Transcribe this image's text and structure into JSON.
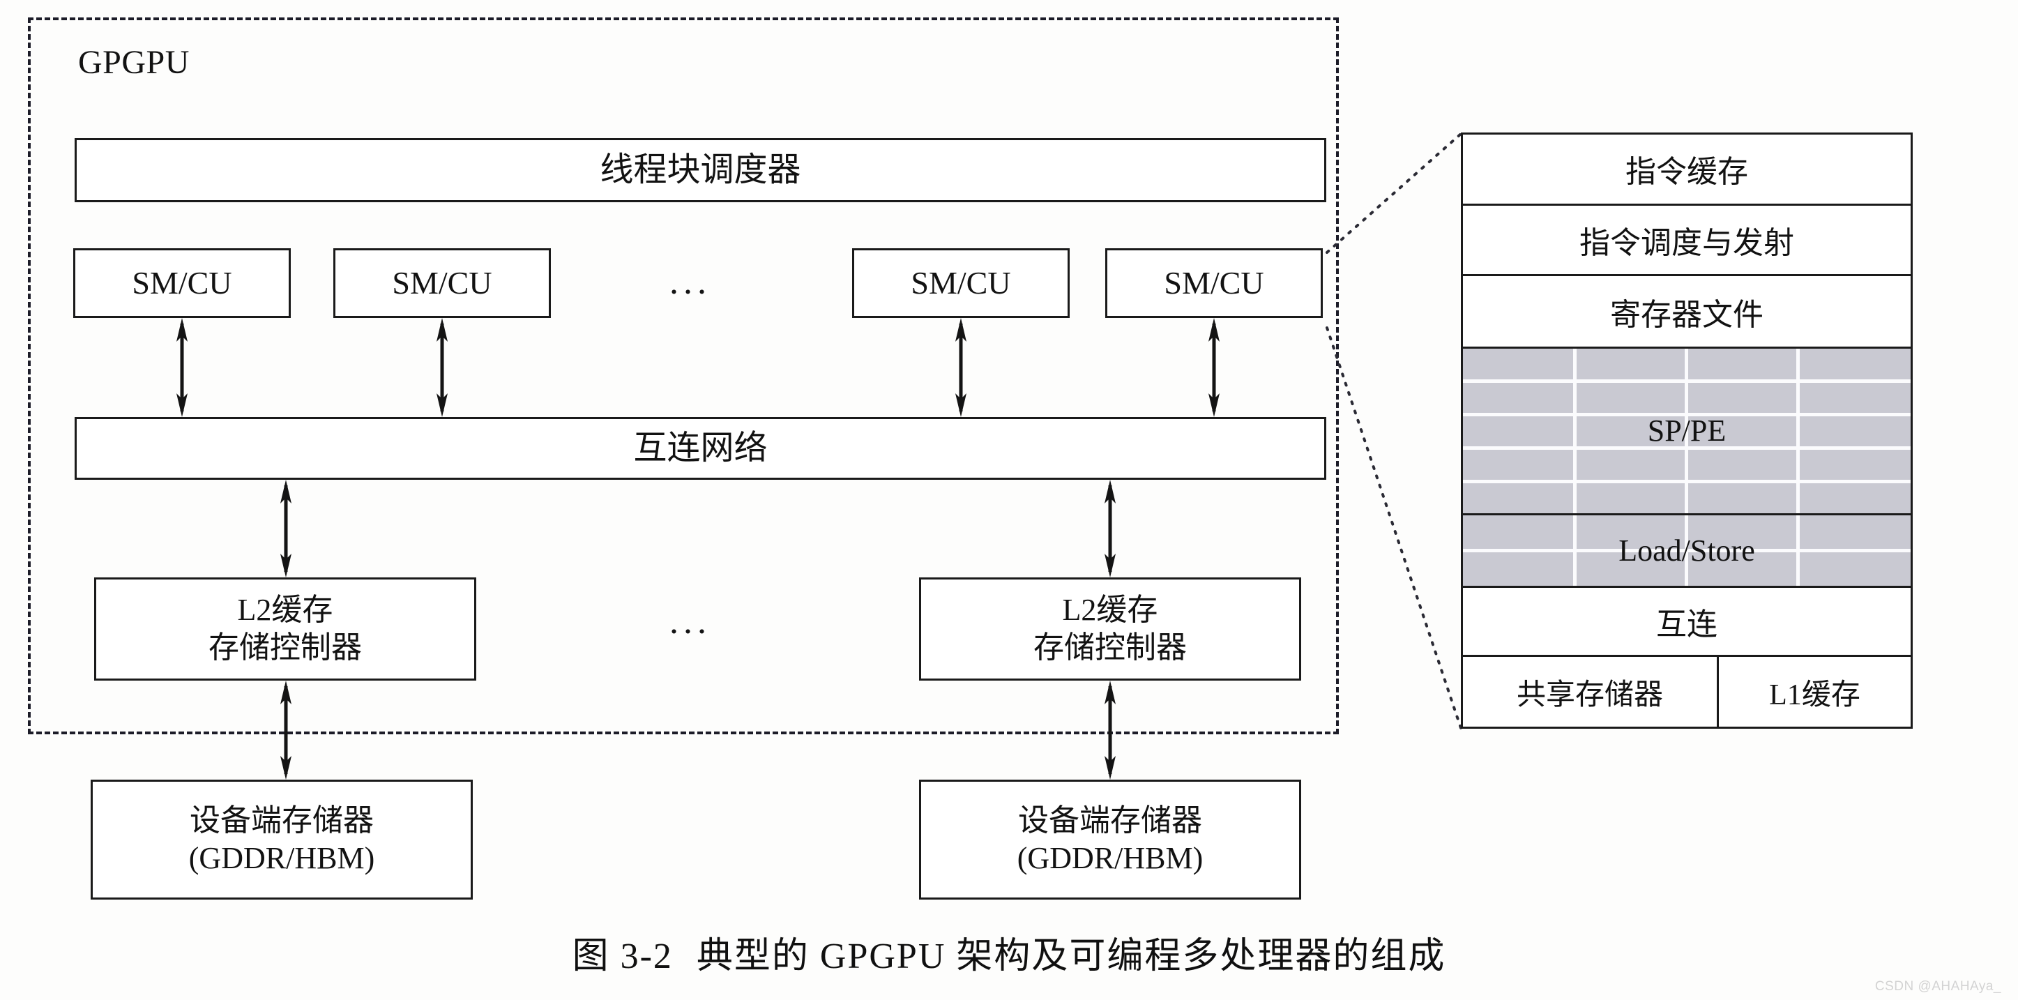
{
  "figure": {
    "caption_number": "图 3-2",
    "caption_text": "典型的 GPGPU 架构及可编程多处理器的组成",
    "watermark": "CSDN @AHAHAya_"
  },
  "gpgpu": {
    "label": "GPGPU",
    "thread_block_scheduler": "线程块调度器",
    "interconnect_network": "互连网络",
    "sm_cu_label": "SM/CU",
    "sm_cu_units": [
      "SM/CU",
      "SM/CU",
      "SM/CU",
      "SM/CU"
    ],
    "sm_ellipsis": "...",
    "l2_ellipsis": "...",
    "l2_units": [
      {
        "line1": "L2缓存",
        "line2": "存储控制器"
      },
      {
        "line1": "L2缓存",
        "line2": "存储控制器"
      }
    ],
    "device_memory_units": [
      {
        "line1": "设备端存储器",
        "line2": "(GDDR/HBM)"
      },
      {
        "line1": "设备端存储器",
        "line2": "(GDDR/HBM)"
      }
    ]
  },
  "sm_detail": {
    "rows": [
      {
        "label": "指令缓存",
        "shaded": false
      },
      {
        "label": "指令调度与发射",
        "shaded": false
      },
      {
        "label": "寄存器文件",
        "shaded": false
      },
      {
        "label": "SP/PE",
        "shaded": true
      },
      {
        "label": "Load/Store",
        "shaded": true
      },
      {
        "label": "互连",
        "shaded": false
      }
    ],
    "bottom_row": {
      "shared_memory": "共享存储器",
      "l1_cache": "L1缓存"
    }
  },
  "colors": {
    "line": "#1a1a1a",
    "shaded_fill": "#c9c9d2",
    "grid_line": "#fbfbfd",
    "background": "#fdfdfc",
    "text": "#121212",
    "watermark": "#d3d3d3"
  }
}
